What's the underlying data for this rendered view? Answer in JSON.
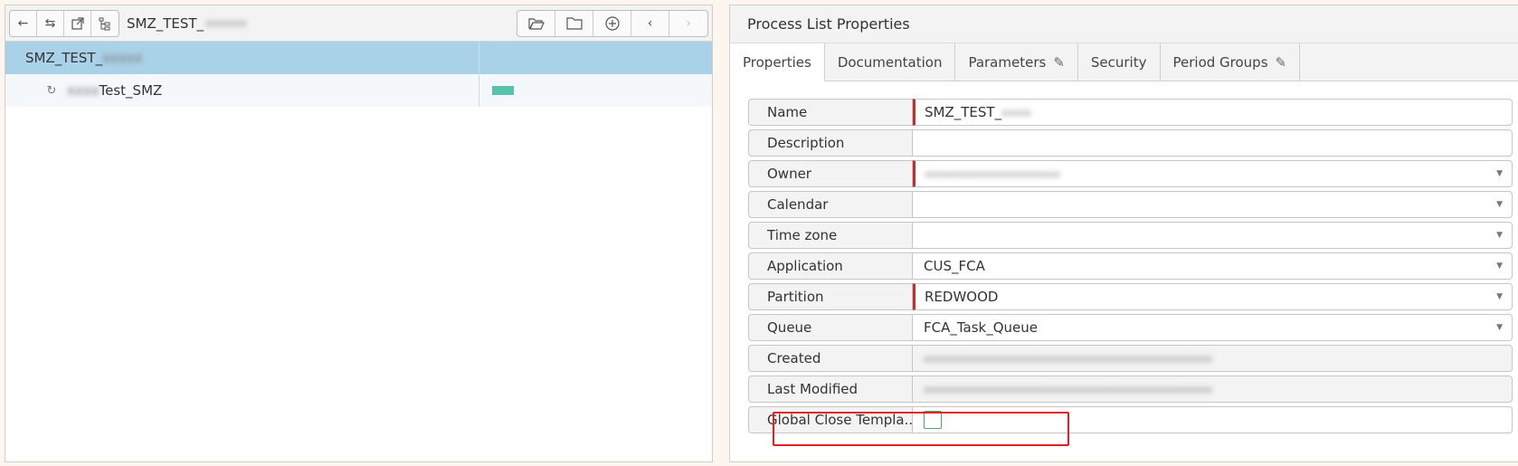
{
  "left_panel": {
    "path_title": "SMZ_TEST_",
    "path_blurred": "xxxxxxx",
    "toolbar_icons": [
      "back-arrow-icon",
      "swap-icon",
      "open-external-icon",
      "tree-view-icon"
    ],
    "tools_right": [
      "folder-open-icon",
      "folder-icon",
      "add-circle-icon",
      "chevron-left-icon",
      "chevron-right-icon"
    ],
    "tree": [
      {
        "label": "SMZ_TEST_",
        "blurred": "xxxxx",
        "selected": true
      },
      {
        "label": "Test_SMZ",
        "blurred_prefix": "xxxx",
        "status_color": "#58c3aa"
      }
    ]
  },
  "right_panel": {
    "title": "Process List Properties",
    "tabs": [
      {
        "label": "Properties",
        "active": true
      },
      {
        "label": "Documentation"
      },
      {
        "label": "Parameters",
        "editable": true
      },
      {
        "label": "Security"
      },
      {
        "label": "Period Groups",
        "editable": true
      }
    ],
    "fields": [
      {
        "label": "Name",
        "value": "SMZ_TEST_",
        "blurred": "xxxxx",
        "required": true
      },
      {
        "label": "Description",
        "value": ""
      },
      {
        "label": "Owner",
        "value": "",
        "blurred": "xxxxxxxxxxxxxxxxxxxxxxx",
        "required": true,
        "dropdown": true
      },
      {
        "label": "Calendar",
        "value": "",
        "dropdown": true
      },
      {
        "label": "Time zone",
        "value": "",
        "dropdown": true
      },
      {
        "label": "Application",
        "value": "CUS_FCA",
        "dropdown": true
      },
      {
        "label": "Partition",
        "value": "REDWOOD",
        "required": true,
        "dropdown": true
      },
      {
        "label": "Queue",
        "value": "FCA_Task_Queue",
        "dropdown": true,
        "highlighted": true
      },
      {
        "label": "Created",
        "value": "",
        "blurred": "xxxxxxxxxxxxxxxxxxxxxxxxxxxxxxxxxxxxxxxxxxxxxxxxx",
        "readonly": true
      },
      {
        "label": "Last Modified",
        "value": "",
        "blurred": "xxxxxxxxxxxxxxxxxxxxxxxxxxxxxxxxxxxxxxxxxxxxxxxxx",
        "readonly": true
      },
      {
        "label": "Global Close Templa...",
        "checkbox": true
      }
    ],
    "colors": {
      "required_marker": "#c62d2d",
      "highlight": "#e02020",
      "selected_row": "#a9d1e8"
    }
  }
}
